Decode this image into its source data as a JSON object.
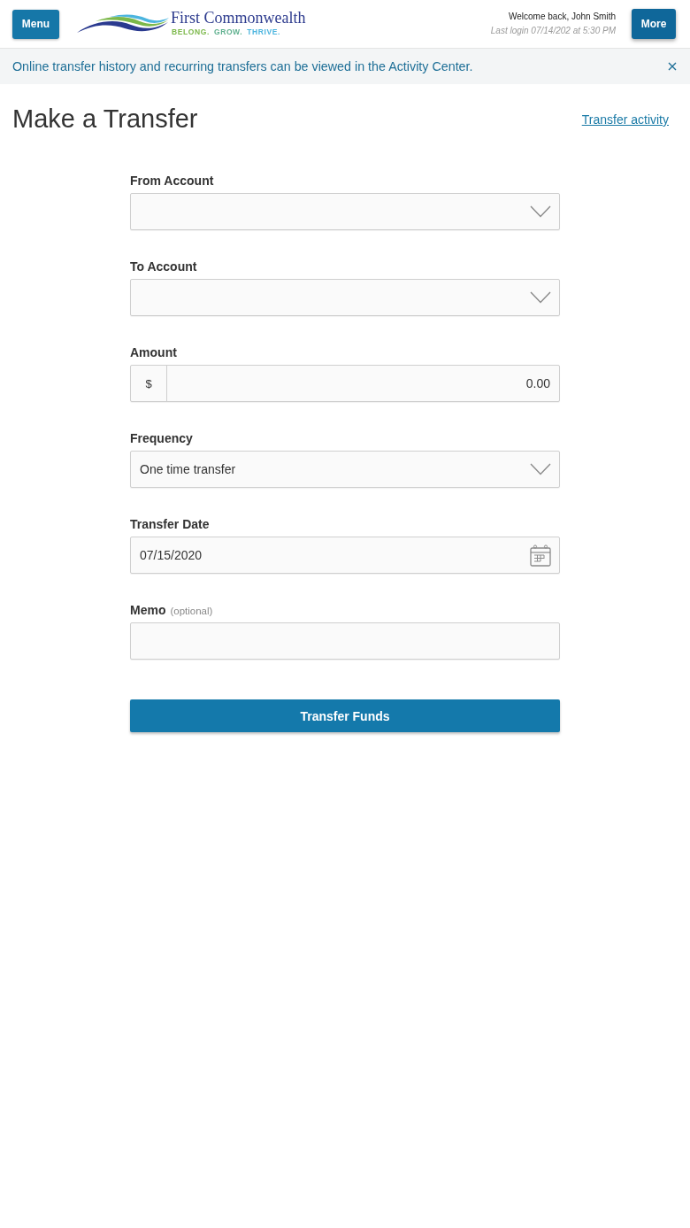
{
  "header": {
    "menu_button": "Menu",
    "logo": {
      "name": "First Commonwealth",
      "tagline": [
        {
          "text": "BELONG.",
          "color": "#7cb84a"
        },
        {
          "text": "GROW.",
          "color": "#5fb08f"
        },
        {
          "text": "THRIVE.",
          "color": "#4cb5df"
        }
      ]
    },
    "welcome": "Welcome back, John Smith",
    "last_login": "Last login 07/14/202 at 5:30 PM",
    "more_button": "More"
  },
  "notice": {
    "text": "Online transfer history and recurring transfers can be viewed in the Activity Center.",
    "dismissible": true
  },
  "page": {
    "title": "Make a Transfer",
    "link": "Transfer activity"
  },
  "form": {
    "fields": [
      {
        "kind": "select",
        "label": "From Account"
      },
      {
        "kind": "select",
        "label": "To Account"
      },
      {
        "kind": "amount",
        "label": "Amount",
        "prefix": "$",
        "value": "0.00"
      },
      {
        "kind": "select",
        "label": "Frequency",
        "value": "One time transfer"
      },
      {
        "kind": "date",
        "label": "Transfer Date",
        "value": "07/15/2020"
      },
      {
        "kind": "text",
        "label": "Memo",
        "note": "(optional)"
      }
    ],
    "submit": "Transfer Funds"
  }
}
